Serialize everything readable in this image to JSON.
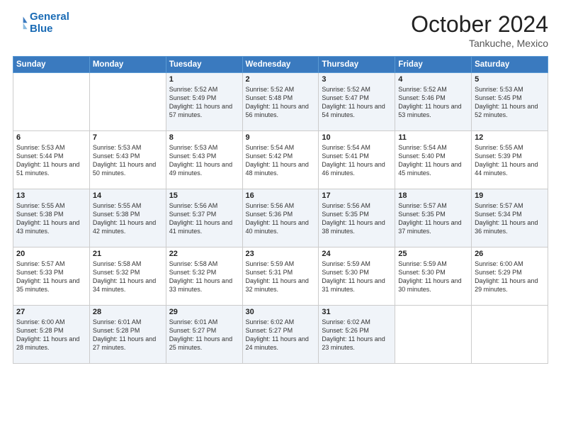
{
  "header": {
    "logo_line1": "General",
    "logo_line2": "Blue",
    "month": "October 2024",
    "location": "Tankuche, Mexico"
  },
  "days_of_week": [
    "Sunday",
    "Monday",
    "Tuesday",
    "Wednesday",
    "Thursday",
    "Friday",
    "Saturday"
  ],
  "weeks": [
    [
      {
        "day": "",
        "info": ""
      },
      {
        "day": "",
        "info": ""
      },
      {
        "day": "1",
        "info": "Sunrise: 5:52 AM\nSunset: 5:49 PM\nDaylight: 11 hours and 57 minutes."
      },
      {
        "day": "2",
        "info": "Sunrise: 5:52 AM\nSunset: 5:48 PM\nDaylight: 11 hours and 56 minutes."
      },
      {
        "day": "3",
        "info": "Sunrise: 5:52 AM\nSunset: 5:47 PM\nDaylight: 11 hours and 54 minutes."
      },
      {
        "day": "4",
        "info": "Sunrise: 5:52 AM\nSunset: 5:46 PM\nDaylight: 11 hours and 53 minutes."
      },
      {
        "day": "5",
        "info": "Sunrise: 5:53 AM\nSunset: 5:45 PM\nDaylight: 11 hours and 52 minutes."
      }
    ],
    [
      {
        "day": "6",
        "info": "Sunrise: 5:53 AM\nSunset: 5:44 PM\nDaylight: 11 hours and 51 minutes."
      },
      {
        "day": "7",
        "info": "Sunrise: 5:53 AM\nSunset: 5:43 PM\nDaylight: 11 hours and 50 minutes."
      },
      {
        "day": "8",
        "info": "Sunrise: 5:53 AM\nSunset: 5:43 PM\nDaylight: 11 hours and 49 minutes."
      },
      {
        "day": "9",
        "info": "Sunrise: 5:54 AM\nSunset: 5:42 PM\nDaylight: 11 hours and 48 minutes."
      },
      {
        "day": "10",
        "info": "Sunrise: 5:54 AM\nSunset: 5:41 PM\nDaylight: 11 hours and 46 minutes."
      },
      {
        "day": "11",
        "info": "Sunrise: 5:54 AM\nSunset: 5:40 PM\nDaylight: 11 hours and 45 minutes."
      },
      {
        "day": "12",
        "info": "Sunrise: 5:55 AM\nSunset: 5:39 PM\nDaylight: 11 hours and 44 minutes."
      }
    ],
    [
      {
        "day": "13",
        "info": "Sunrise: 5:55 AM\nSunset: 5:38 PM\nDaylight: 11 hours and 43 minutes."
      },
      {
        "day": "14",
        "info": "Sunrise: 5:55 AM\nSunset: 5:38 PM\nDaylight: 11 hours and 42 minutes."
      },
      {
        "day": "15",
        "info": "Sunrise: 5:56 AM\nSunset: 5:37 PM\nDaylight: 11 hours and 41 minutes."
      },
      {
        "day": "16",
        "info": "Sunrise: 5:56 AM\nSunset: 5:36 PM\nDaylight: 11 hours and 40 minutes."
      },
      {
        "day": "17",
        "info": "Sunrise: 5:56 AM\nSunset: 5:35 PM\nDaylight: 11 hours and 38 minutes."
      },
      {
        "day": "18",
        "info": "Sunrise: 5:57 AM\nSunset: 5:35 PM\nDaylight: 11 hours and 37 minutes."
      },
      {
        "day": "19",
        "info": "Sunrise: 5:57 AM\nSunset: 5:34 PM\nDaylight: 11 hours and 36 minutes."
      }
    ],
    [
      {
        "day": "20",
        "info": "Sunrise: 5:57 AM\nSunset: 5:33 PM\nDaylight: 11 hours and 35 minutes."
      },
      {
        "day": "21",
        "info": "Sunrise: 5:58 AM\nSunset: 5:32 PM\nDaylight: 11 hours and 34 minutes."
      },
      {
        "day": "22",
        "info": "Sunrise: 5:58 AM\nSunset: 5:32 PM\nDaylight: 11 hours and 33 minutes."
      },
      {
        "day": "23",
        "info": "Sunrise: 5:59 AM\nSunset: 5:31 PM\nDaylight: 11 hours and 32 minutes."
      },
      {
        "day": "24",
        "info": "Sunrise: 5:59 AM\nSunset: 5:30 PM\nDaylight: 11 hours and 31 minutes."
      },
      {
        "day": "25",
        "info": "Sunrise: 5:59 AM\nSunset: 5:30 PM\nDaylight: 11 hours and 30 minutes."
      },
      {
        "day": "26",
        "info": "Sunrise: 6:00 AM\nSunset: 5:29 PM\nDaylight: 11 hours and 29 minutes."
      }
    ],
    [
      {
        "day": "27",
        "info": "Sunrise: 6:00 AM\nSunset: 5:28 PM\nDaylight: 11 hours and 28 minutes."
      },
      {
        "day": "28",
        "info": "Sunrise: 6:01 AM\nSunset: 5:28 PM\nDaylight: 11 hours and 27 minutes."
      },
      {
        "day": "29",
        "info": "Sunrise: 6:01 AM\nSunset: 5:27 PM\nDaylight: 11 hours and 25 minutes."
      },
      {
        "day": "30",
        "info": "Sunrise: 6:02 AM\nSunset: 5:27 PM\nDaylight: 11 hours and 24 minutes."
      },
      {
        "day": "31",
        "info": "Sunrise: 6:02 AM\nSunset: 5:26 PM\nDaylight: 11 hours and 23 minutes."
      },
      {
        "day": "",
        "info": ""
      },
      {
        "day": "",
        "info": ""
      }
    ]
  ]
}
